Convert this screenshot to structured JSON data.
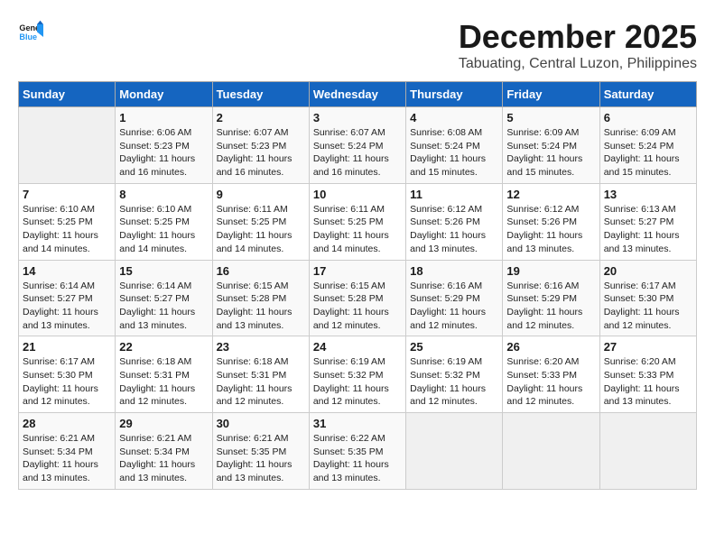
{
  "logo": {
    "text_general": "General",
    "text_blue": "Blue"
  },
  "title": "December 2025",
  "location": "Tabuating, Central Luzon, Philippines",
  "headers": [
    "Sunday",
    "Monday",
    "Tuesday",
    "Wednesday",
    "Thursday",
    "Friday",
    "Saturday"
  ],
  "weeks": [
    [
      {
        "day": "",
        "sunrise": "",
        "sunset": "",
        "daylight": ""
      },
      {
        "day": "1",
        "sunrise": "Sunrise: 6:06 AM",
        "sunset": "Sunset: 5:23 PM",
        "daylight": "Daylight: 11 hours and 16 minutes."
      },
      {
        "day": "2",
        "sunrise": "Sunrise: 6:07 AM",
        "sunset": "Sunset: 5:23 PM",
        "daylight": "Daylight: 11 hours and 16 minutes."
      },
      {
        "day": "3",
        "sunrise": "Sunrise: 6:07 AM",
        "sunset": "Sunset: 5:24 PM",
        "daylight": "Daylight: 11 hours and 16 minutes."
      },
      {
        "day": "4",
        "sunrise": "Sunrise: 6:08 AM",
        "sunset": "Sunset: 5:24 PM",
        "daylight": "Daylight: 11 hours and 15 minutes."
      },
      {
        "day": "5",
        "sunrise": "Sunrise: 6:09 AM",
        "sunset": "Sunset: 5:24 PM",
        "daylight": "Daylight: 11 hours and 15 minutes."
      },
      {
        "day": "6",
        "sunrise": "Sunrise: 6:09 AM",
        "sunset": "Sunset: 5:24 PM",
        "daylight": "Daylight: 11 hours and 15 minutes."
      }
    ],
    [
      {
        "day": "7",
        "sunrise": "Sunrise: 6:10 AM",
        "sunset": "Sunset: 5:25 PM",
        "daylight": "Daylight: 11 hours and 14 minutes."
      },
      {
        "day": "8",
        "sunrise": "Sunrise: 6:10 AM",
        "sunset": "Sunset: 5:25 PM",
        "daylight": "Daylight: 11 hours and 14 minutes."
      },
      {
        "day": "9",
        "sunrise": "Sunrise: 6:11 AM",
        "sunset": "Sunset: 5:25 PM",
        "daylight": "Daylight: 11 hours and 14 minutes."
      },
      {
        "day": "10",
        "sunrise": "Sunrise: 6:11 AM",
        "sunset": "Sunset: 5:25 PM",
        "daylight": "Daylight: 11 hours and 14 minutes."
      },
      {
        "day": "11",
        "sunrise": "Sunrise: 6:12 AM",
        "sunset": "Sunset: 5:26 PM",
        "daylight": "Daylight: 11 hours and 13 minutes."
      },
      {
        "day": "12",
        "sunrise": "Sunrise: 6:12 AM",
        "sunset": "Sunset: 5:26 PM",
        "daylight": "Daylight: 11 hours and 13 minutes."
      },
      {
        "day": "13",
        "sunrise": "Sunrise: 6:13 AM",
        "sunset": "Sunset: 5:27 PM",
        "daylight": "Daylight: 11 hours and 13 minutes."
      }
    ],
    [
      {
        "day": "14",
        "sunrise": "Sunrise: 6:14 AM",
        "sunset": "Sunset: 5:27 PM",
        "daylight": "Daylight: 11 hours and 13 minutes."
      },
      {
        "day": "15",
        "sunrise": "Sunrise: 6:14 AM",
        "sunset": "Sunset: 5:27 PM",
        "daylight": "Daylight: 11 hours and 13 minutes."
      },
      {
        "day": "16",
        "sunrise": "Sunrise: 6:15 AM",
        "sunset": "Sunset: 5:28 PM",
        "daylight": "Daylight: 11 hours and 13 minutes."
      },
      {
        "day": "17",
        "sunrise": "Sunrise: 6:15 AM",
        "sunset": "Sunset: 5:28 PM",
        "daylight": "Daylight: 11 hours and 12 minutes."
      },
      {
        "day": "18",
        "sunrise": "Sunrise: 6:16 AM",
        "sunset": "Sunset: 5:29 PM",
        "daylight": "Daylight: 11 hours and 12 minutes."
      },
      {
        "day": "19",
        "sunrise": "Sunrise: 6:16 AM",
        "sunset": "Sunset: 5:29 PM",
        "daylight": "Daylight: 11 hours and 12 minutes."
      },
      {
        "day": "20",
        "sunrise": "Sunrise: 6:17 AM",
        "sunset": "Sunset: 5:30 PM",
        "daylight": "Daylight: 11 hours and 12 minutes."
      }
    ],
    [
      {
        "day": "21",
        "sunrise": "Sunrise: 6:17 AM",
        "sunset": "Sunset: 5:30 PM",
        "daylight": "Daylight: 11 hours and 12 minutes."
      },
      {
        "day": "22",
        "sunrise": "Sunrise: 6:18 AM",
        "sunset": "Sunset: 5:31 PM",
        "daylight": "Daylight: 11 hours and 12 minutes."
      },
      {
        "day": "23",
        "sunrise": "Sunrise: 6:18 AM",
        "sunset": "Sunset: 5:31 PM",
        "daylight": "Daylight: 11 hours and 12 minutes."
      },
      {
        "day": "24",
        "sunrise": "Sunrise: 6:19 AM",
        "sunset": "Sunset: 5:32 PM",
        "daylight": "Daylight: 11 hours and 12 minutes."
      },
      {
        "day": "25",
        "sunrise": "Sunrise: 6:19 AM",
        "sunset": "Sunset: 5:32 PM",
        "daylight": "Daylight: 11 hours and 12 minutes."
      },
      {
        "day": "26",
        "sunrise": "Sunrise: 6:20 AM",
        "sunset": "Sunset: 5:33 PM",
        "daylight": "Daylight: 11 hours and 12 minutes."
      },
      {
        "day": "27",
        "sunrise": "Sunrise: 6:20 AM",
        "sunset": "Sunset: 5:33 PM",
        "daylight": "Daylight: 11 hours and 13 minutes."
      }
    ],
    [
      {
        "day": "28",
        "sunrise": "Sunrise: 6:21 AM",
        "sunset": "Sunset: 5:34 PM",
        "daylight": "Daylight: 11 hours and 13 minutes."
      },
      {
        "day": "29",
        "sunrise": "Sunrise: 6:21 AM",
        "sunset": "Sunset: 5:34 PM",
        "daylight": "Daylight: 11 hours and 13 minutes."
      },
      {
        "day": "30",
        "sunrise": "Sunrise: 6:21 AM",
        "sunset": "Sunset: 5:35 PM",
        "daylight": "Daylight: 11 hours and 13 minutes."
      },
      {
        "day": "31",
        "sunrise": "Sunrise: 6:22 AM",
        "sunset": "Sunset: 5:35 PM",
        "daylight": "Daylight: 11 hours and 13 minutes."
      },
      {
        "day": "",
        "sunrise": "",
        "sunset": "",
        "daylight": ""
      },
      {
        "day": "",
        "sunrise": "",
        "sunset": "",
        "daylight": ""
      },
      {
        "day": "",
        "sunrise": "",
        "sunset": "",
        "daylight": ""
      }
    ]
  ]
}
